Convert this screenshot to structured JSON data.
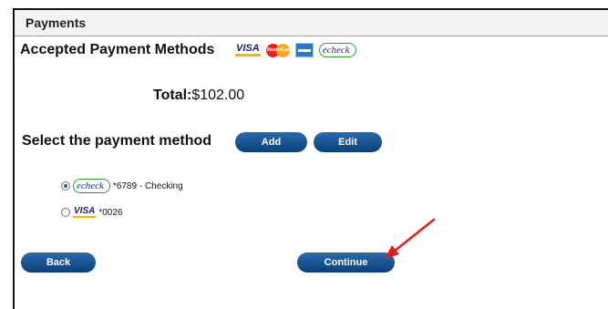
{
  "header": {
    "title": "Payments"
  },
  "accepted": {
    "label": "Accepted Payment Methods",
    "logos": [
      {
        "icon": "visa-logo",
        "text": "VISA"
      },
      {
        "icon": "mastercard-logo",
        "text": "MasterCard"
      },
      {
        "icon": "amex-logo"
      },
      {
        "icon": "echeck-logo",
        "text": "echeck"
      }
    ]
  },
  "total": {
    "label": "Total:",
    "value": "$102.00"
  },
  "select": {
    "label": "Select the payment method",
    "add_label": "Add",
    "edit_label": "Edit"
  },
  "methods": [
    {
      "logo": "echeck",
      "text": "*6789 - Checking",
      "selected": true
    },
    {
      "logo": "VISA",
      "text": "*0026",
      "selected": false
    }
  ],
  "footer": {
    "back_label": "Back",
    "continue_label": "Continue"
  },
  "colors": {
    "button": "#0d4a8a",
    "arrow": "#e02020"
  }
}
